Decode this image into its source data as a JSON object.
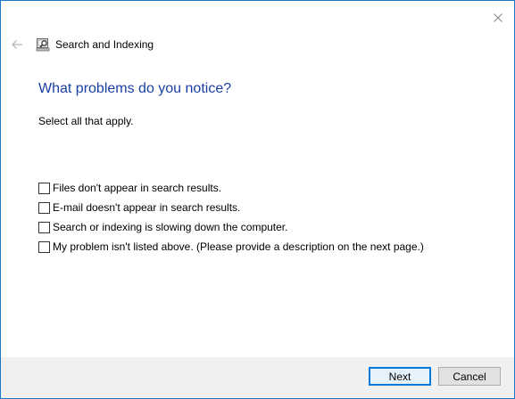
{
  "window": {
    "title": "Search and Indexing",
    "app_icon": "search-indexing-icon",
    "close_icon": "close-icon",
    "back_icon": "back-arrow-icon",
    "border_color": "#1979ca"
  },
  "content": {
    "heading": "What problems do you notice?",
    "heading_color": "#1a3fa4",
    "instruction": "Select all that apply.",
    "options": [
      {
        "label": "Files don't appear in search results.",
        "checked": false
      },
      {
        "label": "E-mail doesn't appear in search results.",
        "checked": false
      },
      {
        "label": "Search or indexing is slowing down the computer.",
        "checked": false
      },
      {
        "label": "My problem isn't listed above. (Please provide a description on the next page.)",
        "checked": false
      }
    ]
  },
  "footer": {
    "next_label": "Next",
    "cancel_label": "Cancel",
    "default_button_color": "#0078d7"
  }
}
